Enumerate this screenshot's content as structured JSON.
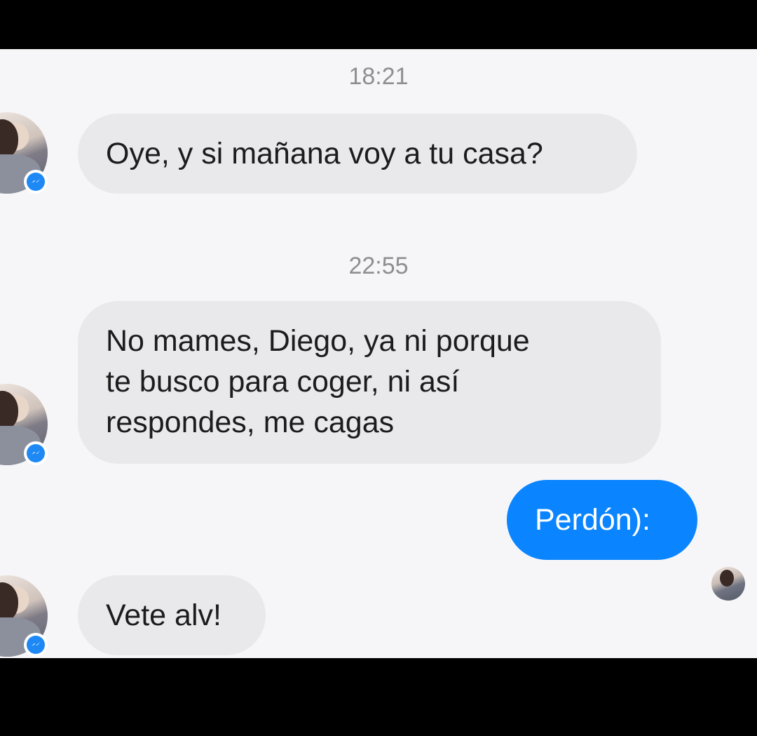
{
  "conversation": {
    "groups": [
      {
        "timestamp": "18:21",
        "message": "Oye, y si mañana voy a tu casa?"
      },
      {
        "timestamp": "22:55",
        "message_lines": [
          "No mames, Diego, ya ni porque",
          "te busco para coger, ni así",
          "respondes, me cagas"
        ]
      }
    ],
    "outgoing": "Perdón):",
    "last_incoming": "Vete alv!"
  },
  "colors": {
    "incoming_bubble": "#e9e9ec",
    "outgoing_bubble": "#0a84ff",
    "messenger_badge": "#1e88f5",
    "background": "#f6f6f8"
  },
  "icons": {
    "contact_avatar": "avatar",
    "badge": "messenger-icon",
    "read_receipt": "read-receipt-avatar"
  }
}
